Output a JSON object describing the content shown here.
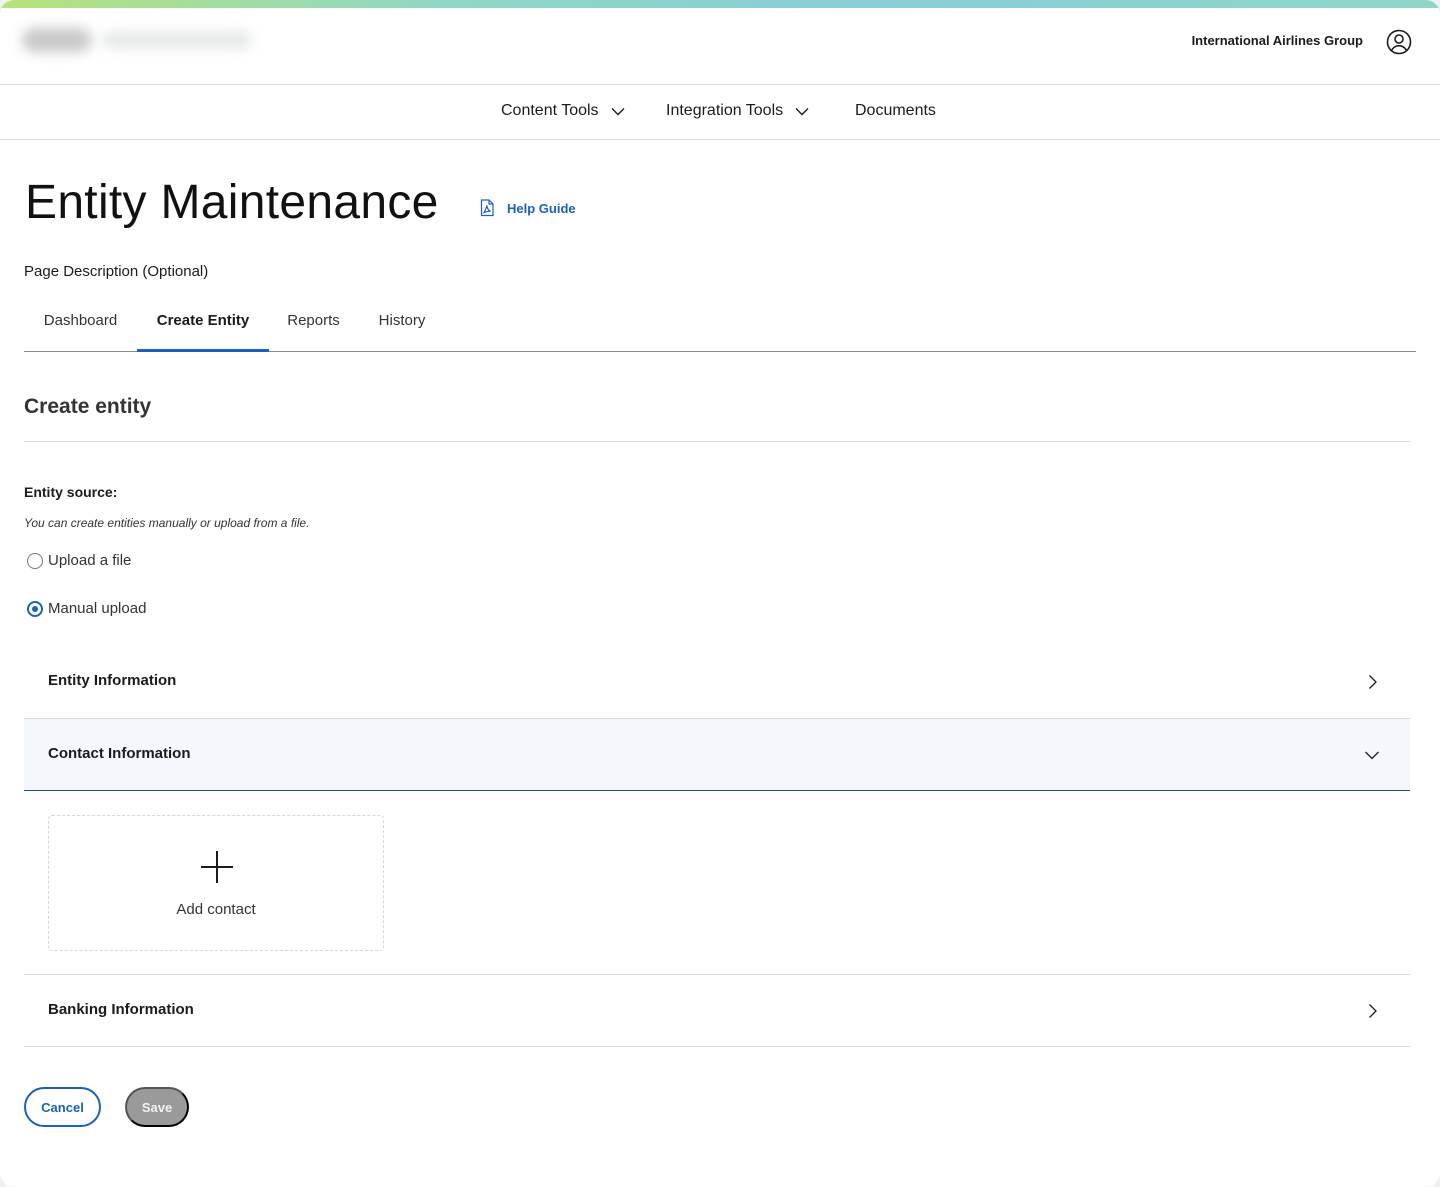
{
  "header": {
    "org_name": "International Airlines Group"
  },
  "nav": {
    "items": [
      {
        "label": "Content Tools",
        "dropdown": true
      },
      {
        "label": "Integration Tools",
        "dropdown": true
      },
      {
        "label": "Documents",
        "dropdown": false
      }
    ]
  },
  "page": {
    "title": "Entity Maintenance",
    "help_label": "Help Guide",
    "description": "Page Description (Optional)"
  },
  "tabs": [
    {
      "label": "Dashboard",
      "active": false
    },
    {
      "label": "Create Entity",
      "active": true
    },
    {
      "label": "Reports",
      "active": false
    },
    {
      "label": "History",
      "active": false
    }
  ],
  "form": {
    "heading": "Create entity",
    "source_label": "Entity source:",
    "source_hint": "You can create entities manually or upload from a file.",
    "options": [
      {
        "label": "Upload a file",
        "selected": false
      },
      {
        "label": "Manual upload",
        "selected": true
      }
    ],
    "sections": [
      {
        "label": "Entity Information",
        "expanded": false
      },
      {
        "label": "Contact Information",
        "expanded": true
      },
      {
        "label": "Banking Information",
        "expanded": false
      }
    ],
    "add_contact_label": "Add contact",
    "cancel_label": "Cancel",
    "save_label": "Save"
  },
  "colors": {
    "accent": "#1b5fbf",
    "disabled": "#9a9a9a"
  }
}
